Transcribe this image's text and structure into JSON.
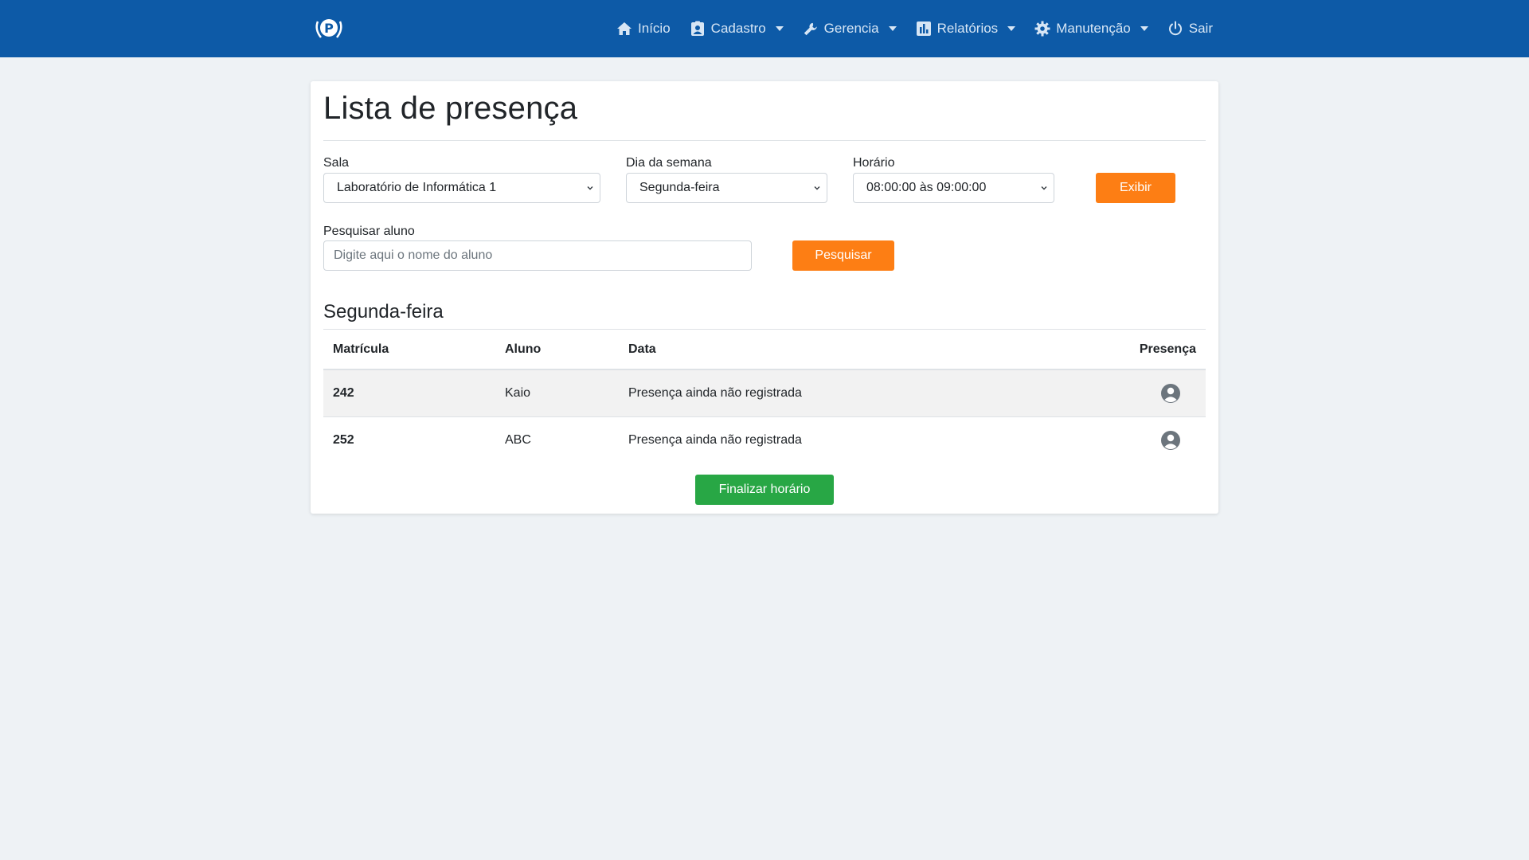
{
  "nav": {
    "items": [
      {
        "label": "Início",
        "icon": "home-icon",
        "dropdown": false
      },
      {
        "label": "Cadastro",
        "icon": "contact-card-icon",
        "dropdown": true
      },
      {
        "label": "Gerencia",
        "icon": "wrench-icon",
        "dropdown": true
      },
      {
        "label": "Relatórios",
        "icon": "bar-chart-icon",
        "dropdown": true
      },
      {
        "label": "Manutenção",
        "icon": "gear-icon",
        "dropdown": true
      },
      {
        "label": "Sair",
        "icon": "power-icon",
        "dropdown": false
      }
    ]
  },
  "page": {
    "title": "Lista de presença"
  },
  "filters": {
    "sala_label": "Sala",
    "sala_value": "Laboratório de Informática 1",
    "dia_label": "Dia da semana",
    "dia_value": "Segunda-feira",
    "horario_label": "Horário",
    "horario_value": "08:00:00 às 09:00:00",
    "exibir_label": "Exibir",
    "search_label": "Pesquisar aluno",
    "search_placeholder": "Digite aqui o nome do aluno",
    "search_button": "Pesquisar"
  },
  "section": {
    "title": "Segunda-feira"
  },
  "table": {
    "headers": [
      "Matrícula",
      "Aluno",
      "Data",
      "Presença"
    ],
    "rows": [
      {
        "matricula": "242",
        "aluno": "Kaio",
        "data": "Presença ainda não registrada",
        "presenca_icon": "user-circle-icon"
      },
      {
        "matricula": "252",
        "aluno": "ABC",
        "data": "Presença ainda não registrada",
        "presenca_icon": "user-circle-icon"
      }
    ]
  },
  "actions": {
    "finalizar_label": "Finalizar horário"
  },
  "colors": {
    "navbar": "#0d5aa7",
    "accent_orange": "#fd7e14",
    "success_green": "#28a745",
    "background": "#eef2f5"
  }
}
